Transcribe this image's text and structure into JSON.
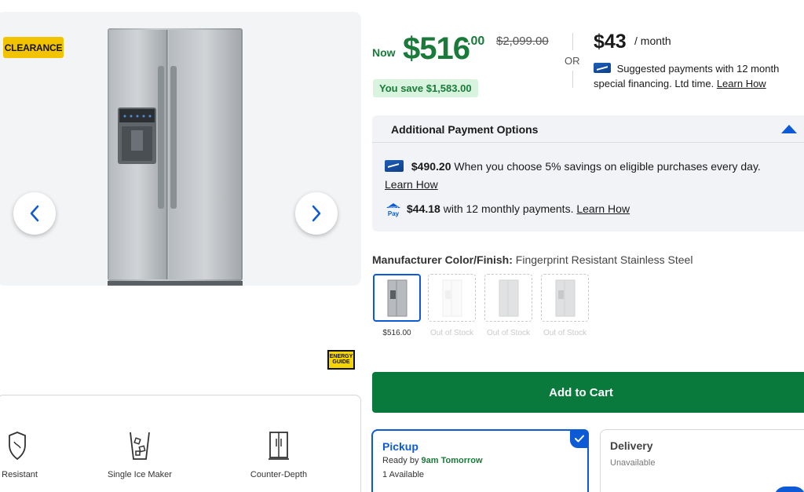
{
  "badges": {
    "clearance": "CLEARANCE",
    "energy_guide": "ENERGY GUIDE"
  },
  "features": [
    {
      "label": "t Resistant",
      "icon": "shield-icon"
    },
    {
      "label": "Single Ice Maker",
      "icon": "ice-cup-icon"
    },
    {
      "label": "Counter-Depth",
      "icon": "refrigerator-icon"
    }
  ],
  "price": {
    "now_label": "Now",
    "dollars": "$516",
    "cents": ".00",
    "was": "$2,099.00",
    "savings": "You save $1,583.00"
  },
  "or_label": "OR",
  "financing": {
    "monthly": "$43",
    "per_month": "/ month",
    "text": "Suggested payments with 12 month special financing. Ltd time.",
    "link": "Learn How"
  },
  "payment_options": {
    "title": "Additional Payment Options",
    "option1": {
      "amount": "$490.20",
      "text": "When you choose 5% savings on eligible purchases every day.",
      "link": "Learn How"
    },
    "option2": {
      "amount": "$44.18",
      "text": "with 12 monthly payments.",
      "link": "Learn How",
      "icon_text_top": "Lowe's",
      "icon_text_bottom": "Pay"
    }
  },
  "color": {
    "label": "Manufacturer Color/Finish:",
    "value": "Fingerprint Resistant Stainless Steel",
    "swatches": [
      {
        "label": "$516.00",
        "available": true
      },
      {
        "label": "Out of Stock",
        "available": false
      },
      {
        "label": "Out of Stock",
        "available": false
      },
      {
        "label": "Out of Stock",
        "available": false
      }
    ]
  },
  "cart": {
    "add_label": "Add to Cart"
  },
  "fulfillment": {
    "pickup": {
      "title": "Pickup",
      "ready_prefix": "Ready by",
      "ready_time": "9am Tomorrow",
      "available": "1 Available"
    },
    "delivery": {
      "title": "Delivery",
      "status": "Unavailable"
    }
  },
  "colors": {
    "accent_green": "#1a7a3a",
    "cart_green": "#0a7a3c",
    "accent_blue": "#0c5ad6",
    "clearance_yellow": "#f2c300"
  }
}
